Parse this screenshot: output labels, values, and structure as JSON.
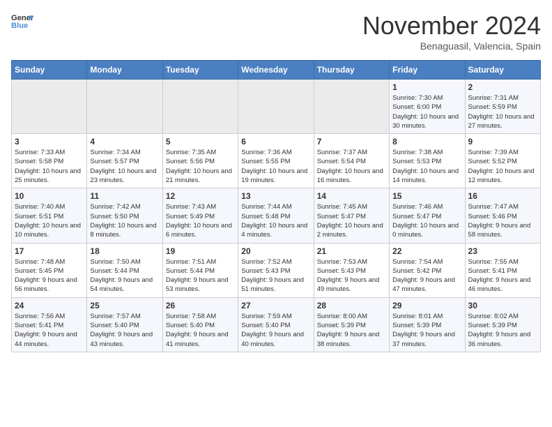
{
  "header": {
    "logo_general": "General",
    "logo_blue": "Blue",
    "month_title": "November 2024",
    "location": "Benaguasil, Valencia, Spain"
  },
  "weekdays": [
    "Sunday",
    "Monday",
    "Tuesday",
    "Wednesday",
    "Thursday",
    "Friday",
    "Saturday"
  ],
  "weeks": [
    [
      {
        "day": "",
        "info": ""
      },
      {
        "day": "",
        "info": ""
      },
      {
        "day": "",
        "info": ""
      },
      {
        "day": "",
        "info": ""
      },
      {
        "day": "",
        "info": ""
      },
      {
        "day": "1",
        "info": "Sunrise: 7:30 AM\nSunset: 6:00 PM\nDaylight: 10 hours and 30 minutes."
      },
      {
        "day": "2",
        "info": "Sunrise: 7:31 AM\nSunset: 5:59 PM\nDaylight: 10 hours and 27 minutes."
      }
    ],
    [
      {
        "day": "3",
        "info": "Sunrise: 7:33 AM\nSunset: 5:58 PM\nDaylight: 10 hours and 25 minutes."
      },
      {
        "day": "4",
        "info": "Sunrise: 7:34 AM\nSunset: 5:57 PM\nDaylight: 10 hours and 23 minutes."
      },
      {
        "day": "5",
        "info": "Sunrise: 7:35 AM\nSunset: 5:56 PM\nDaylight: 10 hours and 21 minutes."
      },
      {
        "day": "6",
        "info": "Sunrise: 7:36 AM\nSunset: 5:55 PM\nDaylight: 10 hours and 19 minutes."
      },
      {
        "day": "7",
        "info": "Sunrise: 7:37 AM\nSunset: 5:54 PM\nDaylight: 10 hours and 16 minutes."
      },
      {
        "day": "8",
        "info": "Sunrise: 7:38 AM\nSunset: 5:53 PM\nDaylight: 10 hours and 14 minutes."
      },
      {
        "day": "9",
        "info": "Sunrise: 7:39 AM\nSunset: 5:52 PM\nDaylight: 10 hours and 12 minutes."
      }
    ],
    [
      {
        "day": "10",
        "info": "Sunrise: 7:40 AM\nSunset: 5:51 PM\nDaylight: 10 hours and 10 minutes."
      },
      {
        "day": "11",
        "info": "Sunrise: 7:42 AM\nSunset: 5:50 PM\nDaylight: 10 hours and 8 minutes."
      },
      {
        "day": "12",
        "info": "Sunrise: 7:43 AM\nSunset: 5:49 PM\nDaylight: 10 hours and 6 minutes."
      },
      {
        "day": "13",
        "info": "Sunrise: 7:44 AM\nSunset: 5:48 PM\nDaylight: 10 hours and 4 minutes."
      },
      {
        "day": "14",
        "info": "Sunrise: 7:45 AM\nSunset: 5:47 PM\nDaylight: 10 hours and 2 minutes."
      },
      {
        "day": "15",
        "info": "Sunrise: 7:46 AM\nSunset: 5:47 PM\nDaylight: 10 hours and 0 minutes."
      },
      {
        "day": "16",
        "info": "Sunrise: 7:47 AM\nSunset: 5:46 PM\nDaylight: 9 hours and 58 minutes."
      }
    ],
    [
      {
        "day": "17",
        "info": "Sunrise: 7:48 AM\nSunset: 5:45 PM\nDaylight: 9 hours and 56 minutes."
      },
      {
        "day": "18",
        "info": "Sunrise: 7:50 AM\nSunset: 5:44 PM\nDaylight: 9 hours and 54 minutes."
      },
      {
        "day": "19",
        "info": "Sunrise: 7:51 AM\nSunset: 5:44 PM\nDaylight: 9 hours and 53 minutes."
      },
      {
        "day": "20",
        "info": "Sunrise: 7:52 AM\nSunset: 5:43 PM\nDaylight: 9 hours and 51 minutes."
      },
      {
        "day": "21",
        "info": "Sunrise: 7:53 AM\nSunset: 5:43 PM\nDaylight: 9 hours and 49 minutes."
      },
      {
        "day": "22",
        "info": "Sunrise: 7:54 AM\nSunset: 5:42 PM\nDaylight: 9 hours and 47 minutes."
      },
      {
        "day": "23",
        "info": "Sunrise: 7:55 AM\nSunset: 5:41 PM\nDaylight: 9 hours and 46 minutes."
      }
    ],
    [
      {
        "day": "24",
        "info": "Sunrise: 7:56 AM\nSunset: 5:41 PM\nDaylight: 9 hours and 44 minutes."
      },
      {
        "day": "25",
        "info": "Sunrise: 7:57 AM\nSunset: 5:40 PM\nDaylight: 9 hours and 43 minutes."
      },
      {
        "day": "26",
        "info": "Sunrise: 7:58 AM\nSunset: 5:40 PM\nDaylight: 9 hours and 41 minutes."
      },
      {
        "day": "27",
        "info": "Sunrise: 7:59 AM\nSunset: 5:40 PM\nDaylight: 9 hours and 40 minutes."
      },
      {
        "day": "28",
        "info": "Sunrise: 8:00 AM\nSunset: 5:39 PM\nDaylight: 9 hours and 38 minutes."
      },
      {
        "day": "29",
        "info": "Sunrise: 8:01 AM\nSunset: 5:39 PM\nDaylight: 9 hours and 37 minutes."
      },
      {
        "day": "30",
        "info": "Sunrise: 8:02 AM\nSunset: 5:39 PM\nDaylight: 9 hours and 36 minutes."
      }
    ]
  ]
}
